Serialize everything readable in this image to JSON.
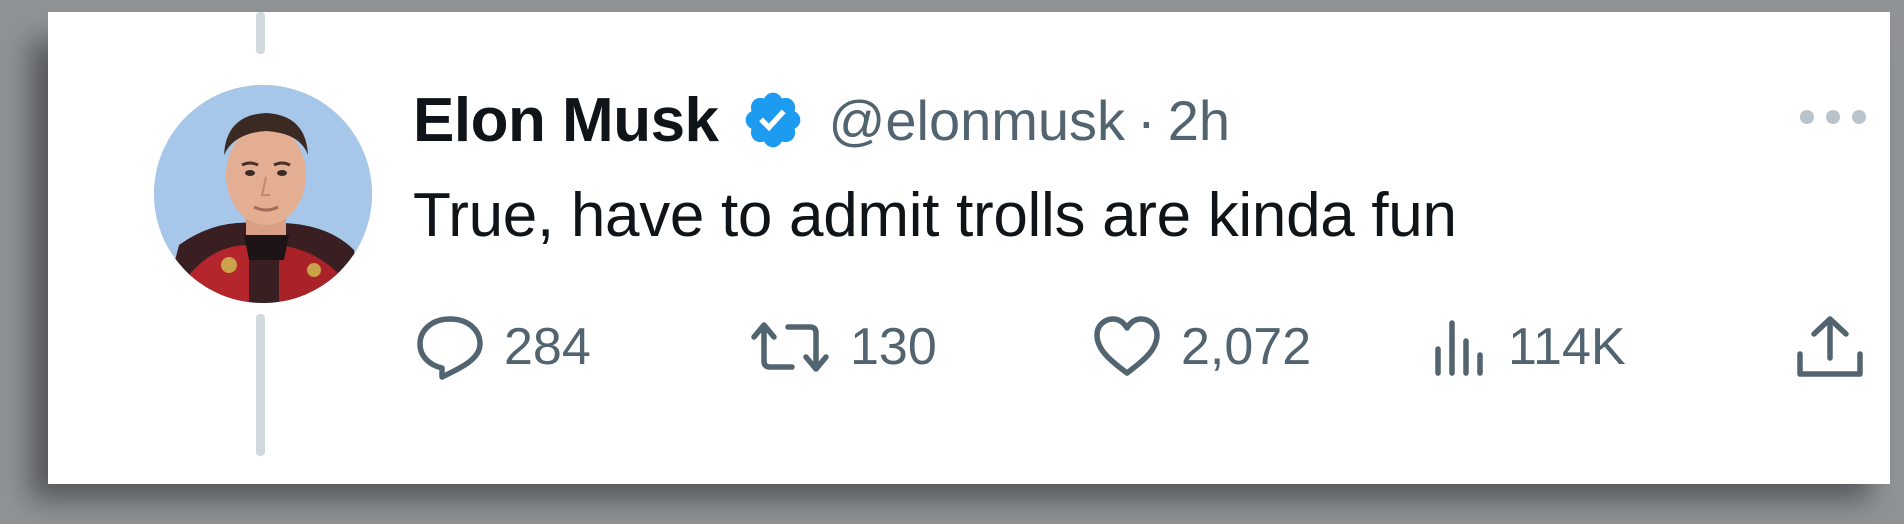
{
  "tweet": {
    "author_name": "Elon Musk",
    "handle": "@elonmusk",
    "separator": "·",
    "time": "2h",
    "text": "True, have to admit trolls are kinda fun",
    "verified_icon": "verified-badge-icon",
    "colors": {
      "verified": "#1d9bf0",
      "secondary": "#536471",
      "primary": "#0f1419"
    }
  },
  "actions": {
    "reply": {
      "icon": "reply-icon",
      "count": "284"
    },
    "retweet": {
      "icon": "retweet-icon",
      "count": "130"
    },
    "like": {
      "icon": "heart-icon",
      "count": "2,072"
    },
    "views": {
      "icon": "views-icon",
      "count": "114K"
    },
    "share": {
      "icon": "share-icon"
    }
  }
}
